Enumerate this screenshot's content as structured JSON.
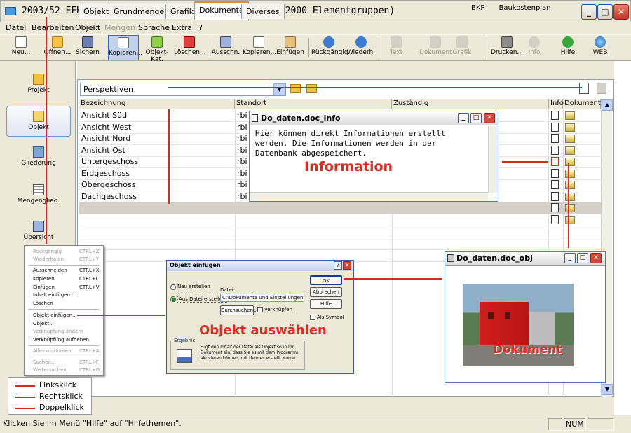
{
  "window": {
    "title": "2003/52 EFH Ätzihofstrasse 16, 8853 Lachen (EKG 2000 Elementgruppen)"
  },
  "menubar": [
    "Datei",
    "Bearbeiten",
    "Objekt",
    "Mengen",
    "Sprache",
    "Extra",
    "?"
  ],
  "toolbar": [
    {
      "label": "Neu...",
      "icon": "new-doc-icon"
    },
    {
      "label": "Öffnen...",
      "icon": "open-folder-icon"
    },
    {
      "label": "Sichern",
      "icon": "save-disk-icon"
    },
    {
      "label": "Kopieren...",
      "icon": "copy-icon"
    },
    {
      "label": "Objekt-Kat.",
      "icon": "object-catalog-icon"
    },
    {
      "label": "Löschen...",
      "icon": "delete-x-icon"
    },
    {
      "label": "Ausschn.",
      "icon": "cut-icon"
    },
    {
      "label": "Kopieren...",
      "icon": "copy-icon"
    },
    {
      "label": "Einfügen",
      "icon": "paste-icon"
    },
    {
      "label": "Rückgängig",
      "icon": "undo-icon"
    },
    {
      "label": "Wiederh.",
      "icon": "redo-icon"
    },
    {
      "label": "Text",
      "icon": "text-icon",
      "disabled": true
    },
    {
      "label": "Dokument",
      "icon": "document-icon",
      "disabled": true
    },
    {
      "label": "Grafik",
      "icon": "graphic-icon",
      "disabled": true
    },
    {
      "label": "Drucken...",
      "icon": "printer-icon"
    },
    {
      "label": "Info",
      "icon": "info-icon",
      "disabled": true
    },
    {
      "label": "Hilfe",
      "icon": "help-icon"
    },
    {
      "label": "WEB",
      "icon": "globe-icon"
    }
  ],
  "sidebar": [
    {
      "label": "Projekt",
      "icon": "project-icon"
    },
    {
      "label": "Objekt",
      "icon": "object-folder-icon",
      "selected": true
    },
    {
      "label": "Gliederung",
      "icon": "structure-icon"
    },
    {
      "label": "Mengenglied.",
      "icon": "quantity-grid-icon"
    },
    {
      "label": "Übersicht",
      "icon": "overview-icon"
    }
  ],
  "tabs": [
    "Objekt",
    "Grundmengen",
    "Grafik",
    "Dokumente",
    "Diverses"
  ],
  "bkp": {
    "code": "BKP",
    "name": "Baukostenplan"
  },
  "combo": {
    "value": "Perspektiven"
  },
  "grid": {
    "columns": [
      "Bezeichnung",
      "Standort",
      "Zuständig",
      "Info",
      "Dokument"
    ],
    "rows": [
      {
        "bezeichnung": "Ansicht Süd",
        "standort": "rbi"
      },
      {
        "bezeichnung": "Ansicht West",
        "standort": "rbi"
      },
      {
        "bezeichnung": "Ansicht Nord",
        "standort": "rbi"
      },
      {
        "bezeichnung": "Ansicht Ost",
        "standort": "rbi"
      },
      {
        "bezeichnung": "Untergeschoss",
        "standort": "rbi"
      },
      {
        "bezeichnung": "Erdgeschoss",
        "standort": "rbi"
      },
      {
        "bezeichnung": "Obergeschoss",
        "standort": "rbi"
      },
      {
        "bezeichnung": "Dachgeschoss",
        "standort": "rbi"
      },
      {
        "bezeichnung": "",
        "standort": ""
      },
      {
        "bezeichnung": "",
        "standort": ""
      }
    ]
  },
  "info_window": {
    "title": "Do_daten.doc_info",
    "text": "Hier können direkt Informationen erstellt\nwerden. Die Informationen werden in der\nDatenbank abgespeichert.",
    "annotation": "Information"
  },
  "doc_window": {
    "title": "Do_daten.doc_obj",
    "annotation": "Dokument"
  },
  "context_menu": [
    {
      "label": "Rückgängig",
      "key": "CTRL+Z",
      "disabled": true
    },
    {
      "label": "Wiederholen",
      "key": "CTRL+Y",
      "disabled": true
    },
    {
      "sep": true
    },
    {
      "label": "Ausschneiden",
      "key": "CTRL+X"
    },
    {
      "label": "Kopieren",
      "key": "CTRL+C"
    },
    {
      "label": "Einfügen",
      "key": "CTRL+V"
    },
    {
      "label": "Inhalt einfügen...",
      "key": ""
    },
    {
      "label": "Löschen",
      "key": ""
    },
    {
      "sep": true
    },
    {
      "label": "Objekt einfügen...",
      "key": ""
    },
    {
      "label": "Objekt...",
      "key": ""
    },
    {
      "label": "Verknüpfung ändern",
      "key": "",
      "disabled": true
    },
    {
      "label": "Verknüpfung aufheben",
      "key": ""
    },
    {
      "sep": true
    },
    {
      "label": "Alles markieren",
      "key": "CTRL+A",
      "disabled": true
    },
    {
      "sep": true
    },
    {
      "label": "Suchen...",
      "key": "CTRL+F",
      "disabled": true
    },
    {
      "label": "Weitersuchen",
      "key": "CTRL+G",
      "disabled": true
    }
  ],
  "dialog": {
    "title": "Objekt einfügen",
    "radio_new": "Neu erstellen",
    "radio_file": "Aus Datei erstellen",
    "file_label": "Datei:",
    "file_value": "C:\\Dokumente und Einstellungen\\Rueth",
    "browse": "Durchsuchen...",
    "link": "Verknüpfen",
    "ok": "OK",
    "cancel": "Abbrechen",
    "help": "Hilfe",
    "as_symbol": "Als Symbol",
    "result_label": "Ergebnis",
    "result_text": "Fügt den Inhalt der Datei als Objekt so in Ihr Dokument ein, dass Sie es mit dem Programm aktivieren können, mit dem es erstellt wurde.",
    "annotation": "Objekt auswählen"
  },
  "legend": [
    "Linksklick",
    "Rechtsklick",
    "Doppelklick"
  ],
  "statusbar": {
    "text": "Klicken Sie im Menü \"Hilfe\" auf \"Hilfethemen\".",
    "num": "NUM"
  },
  "colors": {
    "annotation_red": "#e3281d",
    "chrome": "#ece9d8",
    "titlebar_blue": "#2b54a8"
  }
}
